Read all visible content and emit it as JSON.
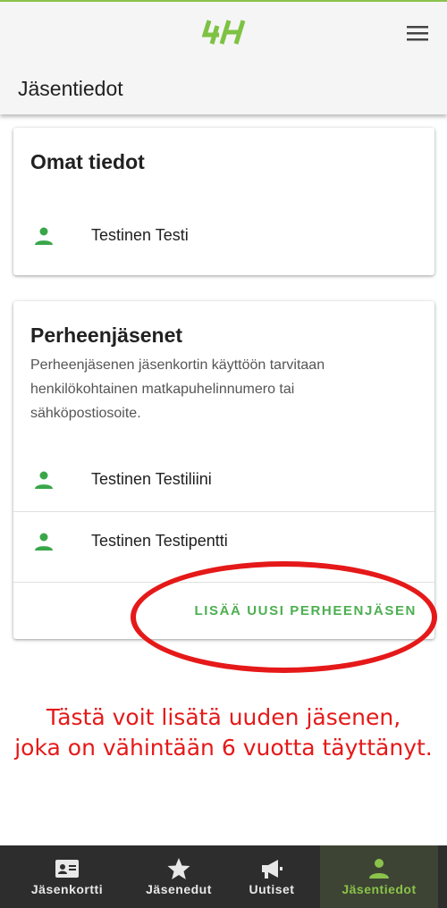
{
  "header": {
    "logo_text": "4H",
    "page_title": "Jäsentiedot"
  },
  "own_info": {
    "title": "Omat tiedot",
    "person": "Testinen Testi"
  },
  "family": {
    "title": "Perheenjäsenet",
    "description": "Perheenjäsenen jäsenkortin käyttöön tarvitaan henkilökohtainen matkapuhelinnumero tai sähköpostiosoite.",
    "members": [
      "Testinen Testiliini",
      "Testinen Testipentti"
    ],
    "add_button": "LISÄÄ UUSI PERHEENJÄSEN"
  },
  "annotation": {
    "line1": "Tästä voit lisätä uuden jäsenen,",
    "line2": "joka on vähintään 6 vuotta täyttänyt."
  },
  "bottom_nav": {
    "items": [
      {
        "label": "Jäsenkortti",
        "icon": "id-card-icon"
      },
      {
        "label": "Jäsenedut",
        "icon": "star-icon"
      },
      {
        "label": "Uutiset",
        "icon": "megaphone-icon"
      },
      {
        "label": "Jäsentiedot",
        "icon": "person-icon",
        "active": true
      }
    ]
  },
  "colors": {
    "accent": "#4caf50",
    "brand_green": "#8bc34a",
    "annotation_red": "#e51919",
    "nav_background": "#2d2d2d"
  }
}
